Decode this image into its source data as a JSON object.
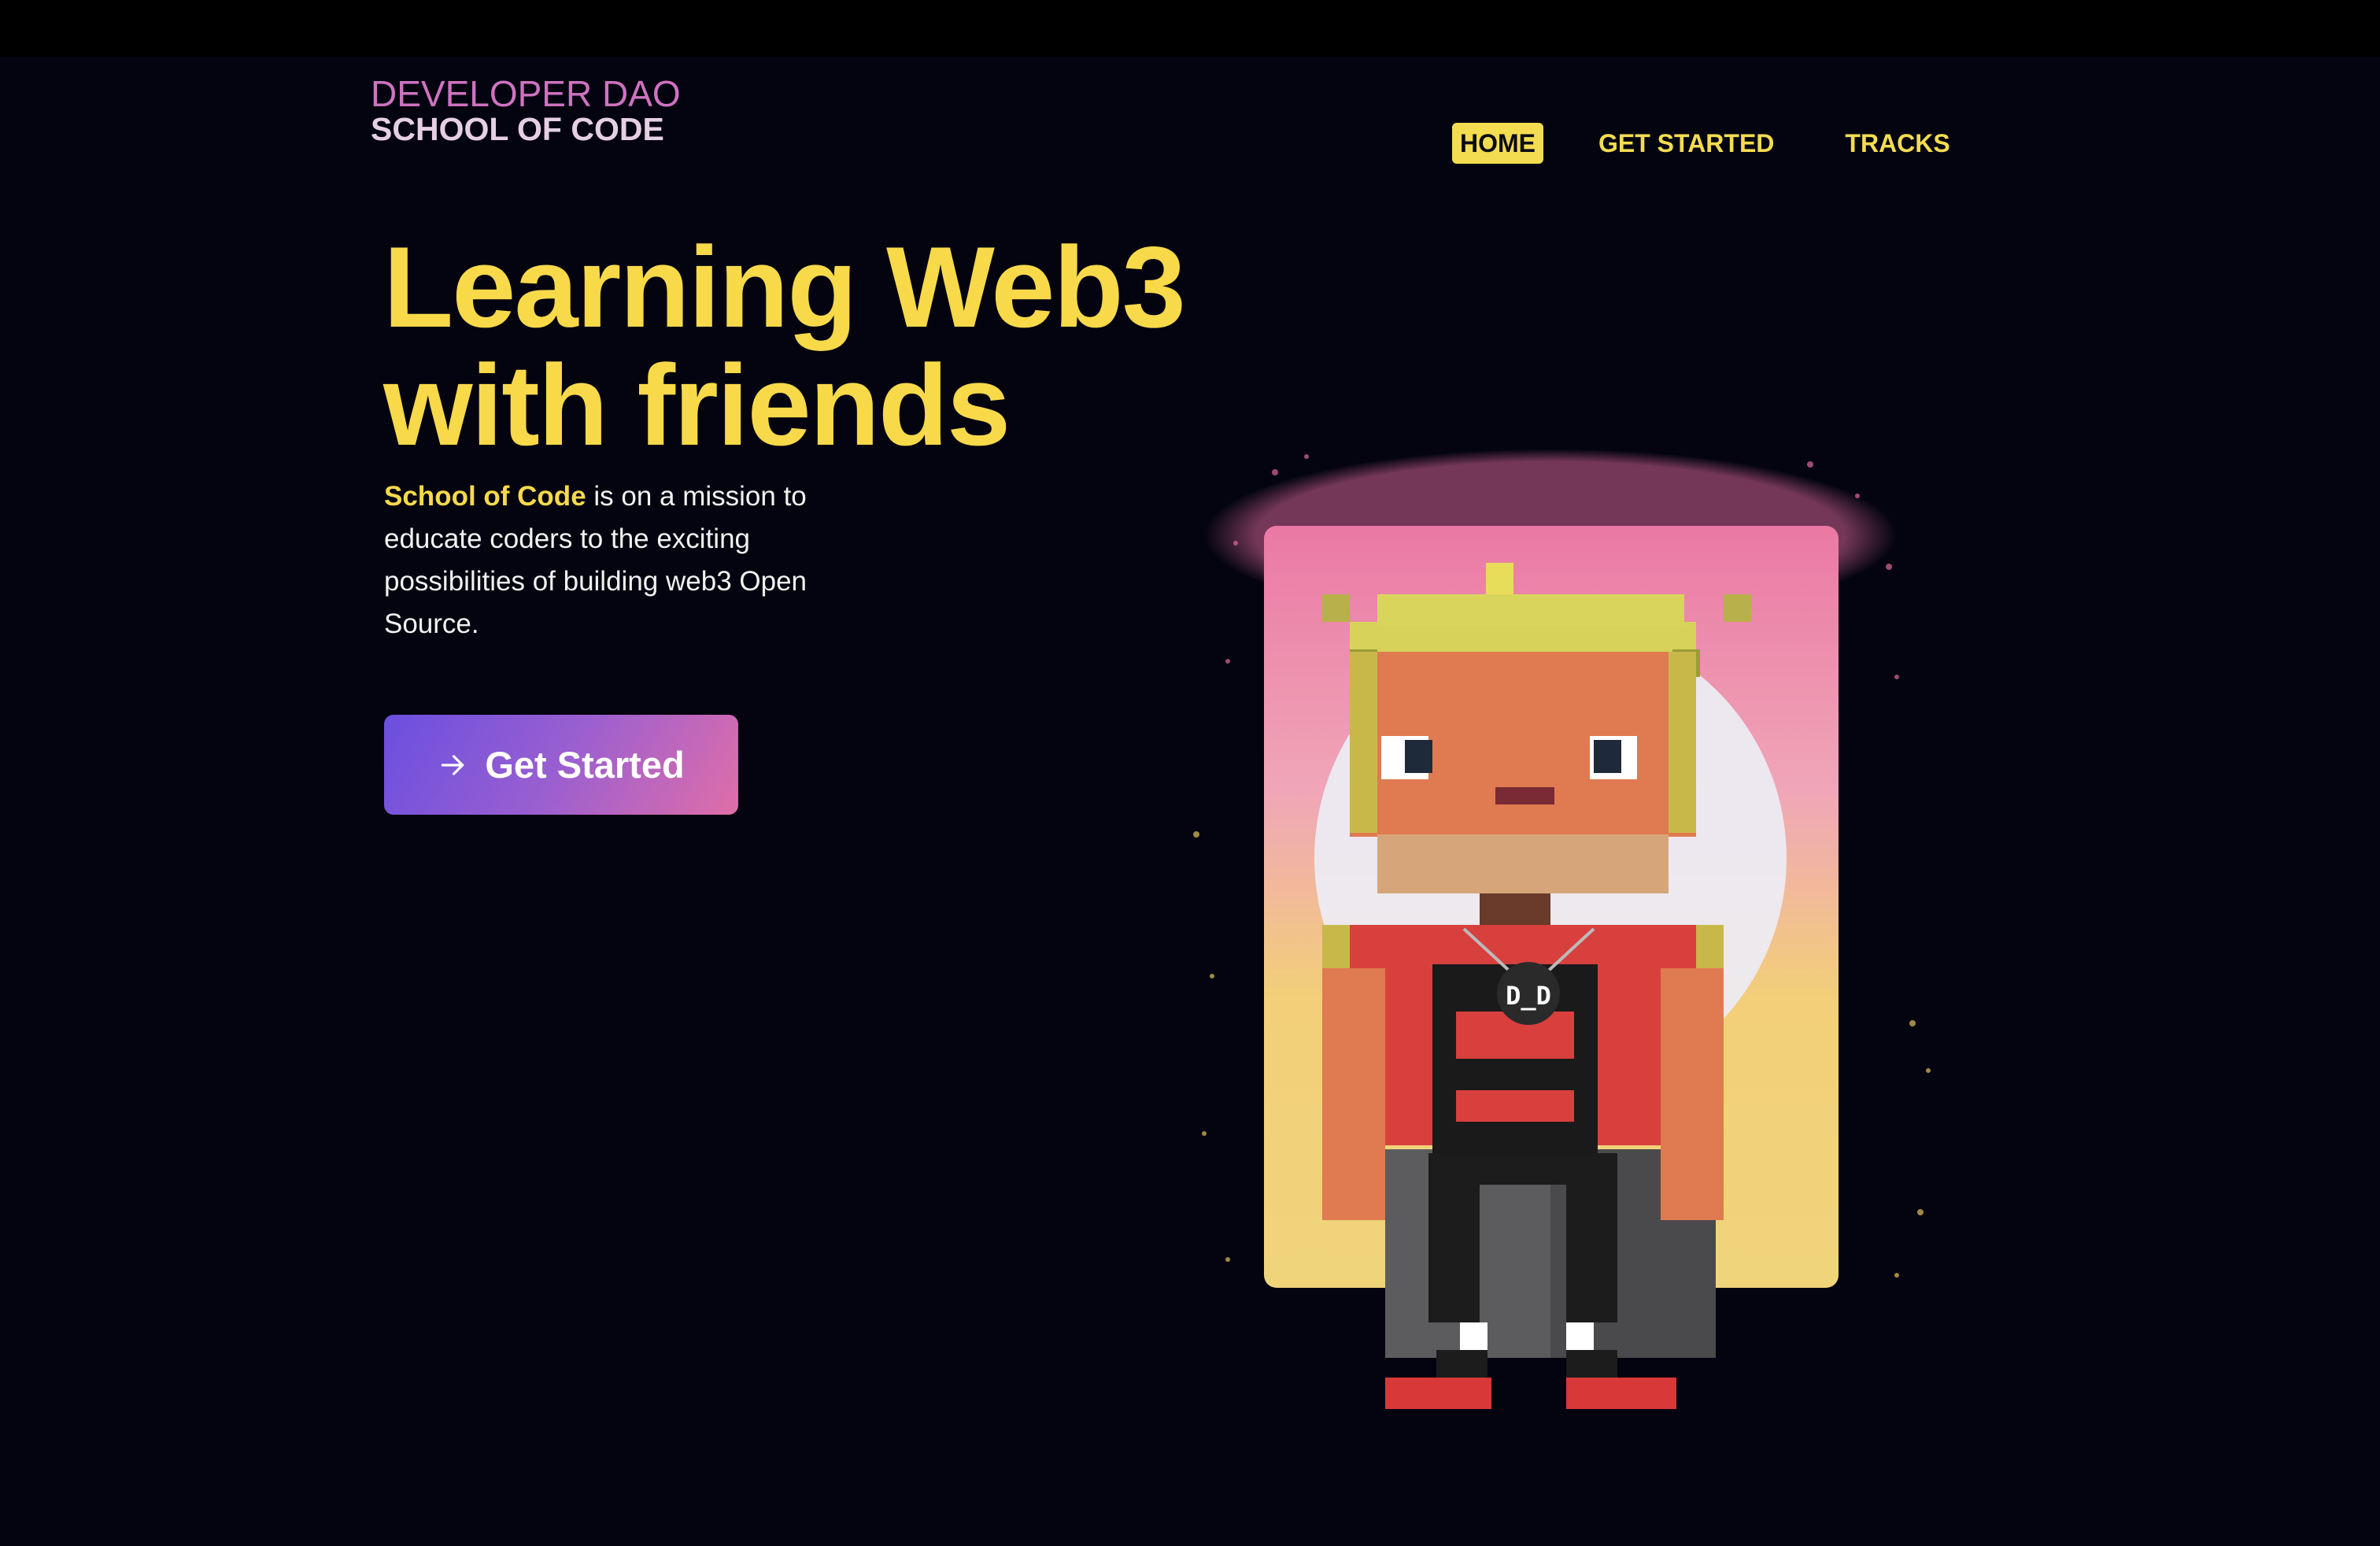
{
  "brand": {
    "line1": "DEVELOPER DAO",
    "line2": "SCHOOL OF CODE"
  },
  "nav": {
    "items": [
      {
        "label": "HOME",
        "active": true
      },
      {
        "label": "GET STARTED",
        "active": false
      },
      {
        "label": "TRACKS",
        "active": false
      }
    ]
  },
  "hero": {
    "headline_line1": "Learning Web3",
    "headline_line2": "with friends",
    "desc_highlight": "School of Code",
    "desc_rest": " is on a mission to educate coders to the exciting possibilities of building web3 Open Source.",
    "cta_label": "Get Started",
    "cta_icon": "arrow-right-icon"
  },
  "illustration": {
    "badge_text": "D_D"
  },
  "colors": {
    "background": "#03040f",
    "accent_yellow": "#f8d94a",
    "brand_pink": "#cf72c1",
    "cta_gradient_start": "#6a4fe0",
    "cta_gradient_end": "#e06ea8"
  }
}
